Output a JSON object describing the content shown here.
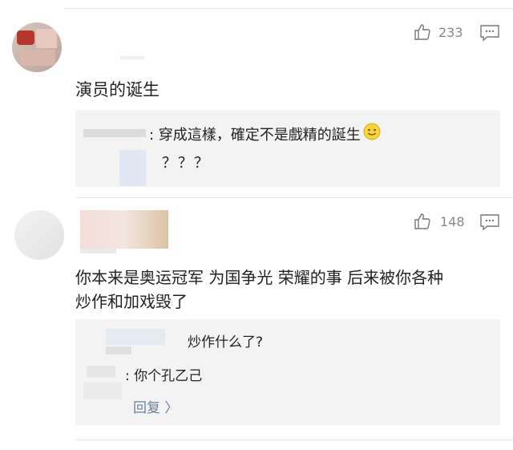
{
  "comments": [
    {
      "likes": "233",
      "text": "演员的诞生",
      "replies": [
        {
          "text": ": 穿成這樣，確定不是戲精的誕生"
        },
        {
          "text": "？？？"
        }
      ]
    },
    {
      "likes": "148",
      "text_line1": "你本来是奥运冠军 为国争光 荣耀的事 后来被你各种",
      "text_line2": "炒作和加戏毁了",
      "replies": [
        {
          "text": "炒作什么了?"
        },
        {
          "text": ": 你个孔乙己"
        }
      ],
      "reply_link": "回复 〉"
    }
  ],
  "icons": {
    "like": "thumbs-up-icon",
    "comment": "comment-icon",
    "emoji": "smiley-emoji-icon"
  },
  "colors": {
    "background": "#ffffff",
    "reply_background": "#f3f3f3",
    "link": "#6a7fa0",
    "meta": "#888888"
  }
}
